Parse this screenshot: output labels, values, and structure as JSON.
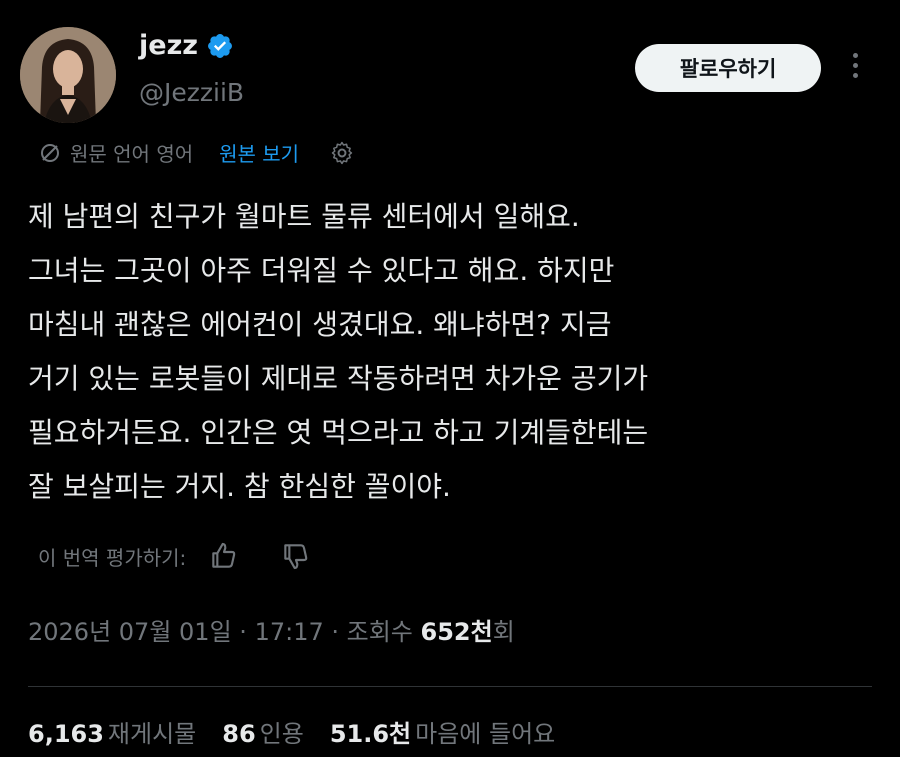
{
  "author": {
    "display_name": "jezz",
    "handle": "@JezziiB",
    "verified_icon": "verified-badge-icon"
  },
  "follow_button_label": "팔로우하기",
  "translation": {
    "source_label": "원문 언어 영어",
    "view_original_label": "원본 보기"
  },
  "tweet_lines": [
    "제 남편의 친구가 월마트 물류 센터에서 일해요.",
    "그녀는 그곳이 아주 더워질 수 있다고 해요. 하지만",
    "마침내 괜찮은 에어컨이 생겼대요. 왜냐하면? 지금",
    "거기 있는 로봇들이 제대로 작동하려면 차가운 공기가",
    "필요하거든요. 인간은 엿 먹으라고 하고 기계들한테는",
    "잘 보살피는 거지. 참 한심한 꼴이야."
  ],
  "rate_translation_label": "이 번역 평가하기:",
  "meta": {
    "date": "2026년 07월 01일",
    "time": "17:17",
    "views_label": "조회수",
    "views_count": "652천",
    "views_suffix": "회"
  },
  "stats": {
    "reposts_count": "6,163",
    "reposts_label": "재게시물",
    "quotes_count": "86",
    "quotes_label": "인용",
    "likes_count": "51.6천",
    "likes_label": "마음에 들어요"
  },
  "colors": {
    "background": "#000000",
    "text": "#e7e9ea",
    "secondary": "#71767b",
    "link": "#1d9bf0",
    "follow_bg": "#eff3f4"
  }
}
